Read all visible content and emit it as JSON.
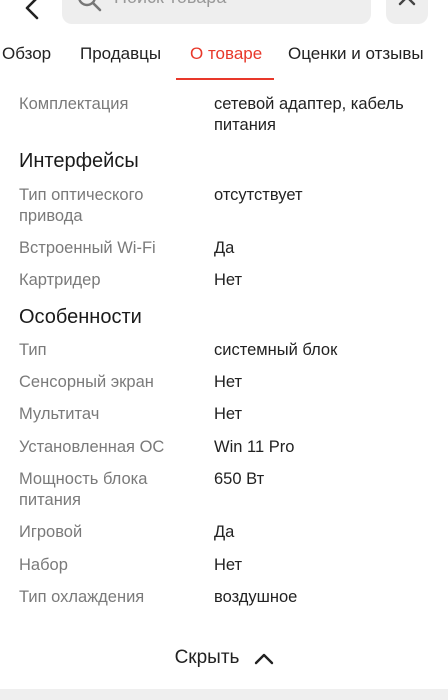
{
  "search": {
    "placeholder": "Поиск товара"
  },
  "tabs": [
    {
      "label": "Обзор",
      "active": false
    },
    {
      "label": "Продавцы",
      "active": false
    },
    {
      "label": "О товаре",
      "active": true
    },
    {
      "label": "Оценки и отзывы",
      "active": false
    }
  ],
  "specs": {
    "top_rows": [
      {
        "key": "Комплектация",
        "value": "сетевой адаптер, кабель питания"
      }
    ],
    "sections": [
      {
        "title": "Интерфейсы",
        "rows": [
          {
            "key": "Тип оптического привода",
            "value": "отсутствует"
          },
          {
            "key": "Встроенный Wi-Fi",
            "value": "Да"
          },
          {
            "key": "Картридер",
            "value": "Нет"
          }
        ]
      },
      {
        "title": "Особенности",
        "rows": [
          {
            "key": "Тип",
            "value": "системный блок"
          },
          {
            "key": "Сенсорный экран",
            "value": "Нет"
          },
          {
            "key": "Мультитач",
            "value": "Нет"
          },
          {
            "key": "Установленная ОС",
            "value": "Win 11 Pro"
          },
          {
            "key": "Мощность блока питания",
            "value": "650 Вт"
          },
          {
            "key": "Игровой",
            "value": "Да"
          },
          {
            "key": "Набор",
            "value": "Нет"
          },
          {
            "key": "Тип охлаждения",
            "value": "воздушное"
          }
        ]
      }
    ]
  },
  "hide_button": {
    "label": "Скрыть",
    "icon": "chevron-up-icon"
  },
  "colors": {
    "accent": "#e8382a",
    "key_text": "#7a7a7a",
    "value_text": "#222222"
  }
}
